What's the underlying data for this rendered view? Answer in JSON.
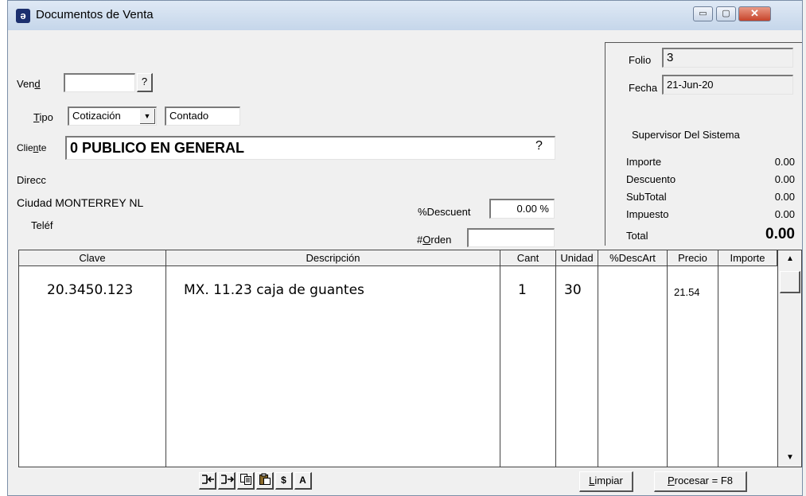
{
  "window": {
    "title": "Documentos de Venta",
    "controls": {
      "minimize": "▭",
      "maximize": "▢",
      "close": "✕"
    }
  },
  "form": {
    "vend": {
      "prefix": "Ven",
      "accel": "d",
      "value": "",
      "lookup": "?"
    },
    "tipo": {
      "accel": "T",
      "rest": "ipo",
      "value": "Cotización",
      "arrow": "▼",
      "payment": "Contado"
    },
    "cliente": {
      "prefix": "Clie",
      "accel": "n",
      "rest": "te",
      "value": "0 PUBLICO EN GENERAL",
      "lookup": "?"
    },
    "direcc_label": "Direcc",
    "ciudad": "Ciudad MONTERREY NL",
    "telef_label": "Teléf",
    "descuento": {
      "label": "%Descuent",
      "value": "0.00 %"
    },
    "orden": {
      "prefix": "#",
      "accel": "O",
      "rest": "rden",
      "value": ""
    }
  },
  "summary": {
    "folio_label": "Folio",
    "folio": "3",
    "fecha_label": "Fecha",
    "fecha": "21-Jun-20",
    "user": "Supervisor Del Sistema",
    "rows": [
      {
        "label": "Importe",
        "value": "0.00"
      },
      {
        "label": "Descuento",
        "value": "0.00"
      },
      {
        "label": "SubTotal",
        "value": "0.00"
      },
      {
        "label": "Impuesto",
        "value": "0.00"
      }
    ],
    "total_label": "Total",
    "total": "0.00"
  },
  "grid": {
    "columns": [
      "Clave",
      "Descripción",
      "Cant",
      "Unidad",
      "%DescArt",
      "Precio",
      "Importe"
    ],
    "rows": [
      {
        "clave": "20.3450.123",
        "descripcion": "MX. 11.23 caja de guantes",
        "cant": "1",
        "unidad": "30",
        "descart": "",
        "precio": "21.54",
        "importe": ""
      }
    ],
    "scroll_up": "▲",
    "scroll_down": "▼"
  },
  "toolbar": {
    "icons": [
      "indent-left-icon",
      "indent-right-icon",
      "copy-icon",
      "paste-icon",
      "dollar-icon",
      "font-a-icon"
    ],
    "dollar": "$",
    "letter_a": "A",
    "limpiar": {
      "accel": "L",
      "rest": "impiar"
    },
    "procesar": {
      "accel": "P",
      "rest": "rocesar = F8"
    }
  }
}
